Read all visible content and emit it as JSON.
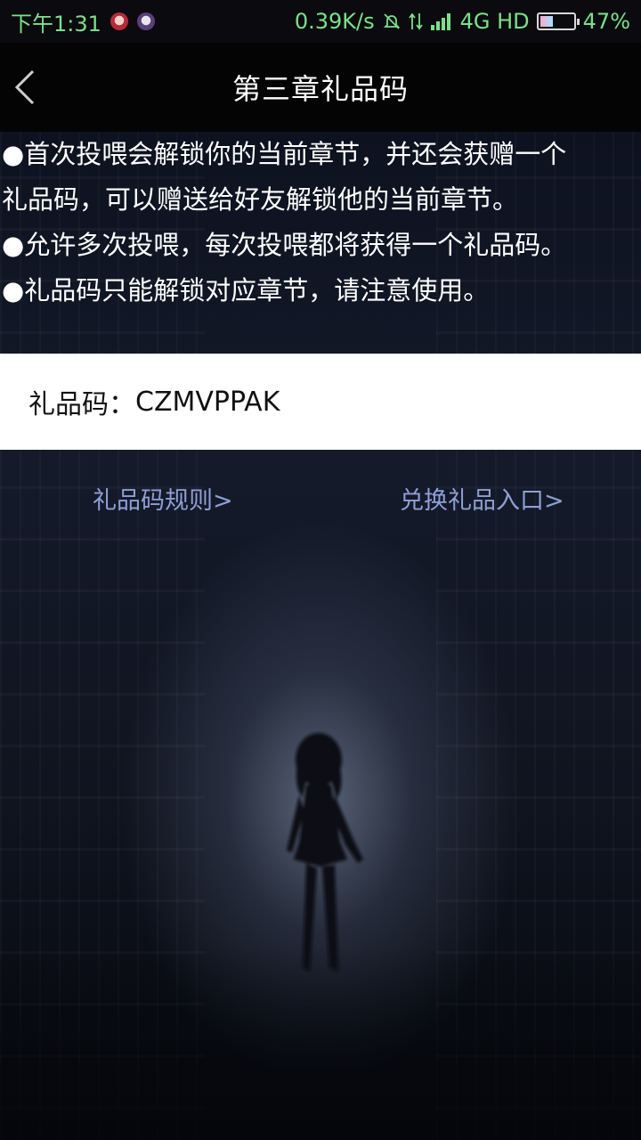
{
  "status_bar": {
    "time": "下午1:31",
    "net_speed": "0.39K/s",
    "network": "4G HD",
    "battery": "47%",
    "battery_level": 0.47
  },
  "nav": {
    "title": "第三章礼品码"
  },
  "rules": {
    "lines": [
      "●首次投喂会解锁你的当前章节，并还会获赠一个",
      "礼品码，可以赠送给好友解锁他的当前章节。",
      "●允许多次投喂，每次投喂都将获得一个礼品码。",
      "●礼品码只能解锁对应章节，请注意使用。"
    ]
  },
  "gift_code": {
    "label": "礼品码：",
    "value": "CZMVPPAK"
  },
  "links": {
    "rules_label": "礼品码规则>",
    "redeem_label": "兑换礼品入口>"
  },
  "colors": {
    "link": "#8f9fd6",
    "status_text": "#7be08a",
    "nav_bg": "#040405"
  }
}
